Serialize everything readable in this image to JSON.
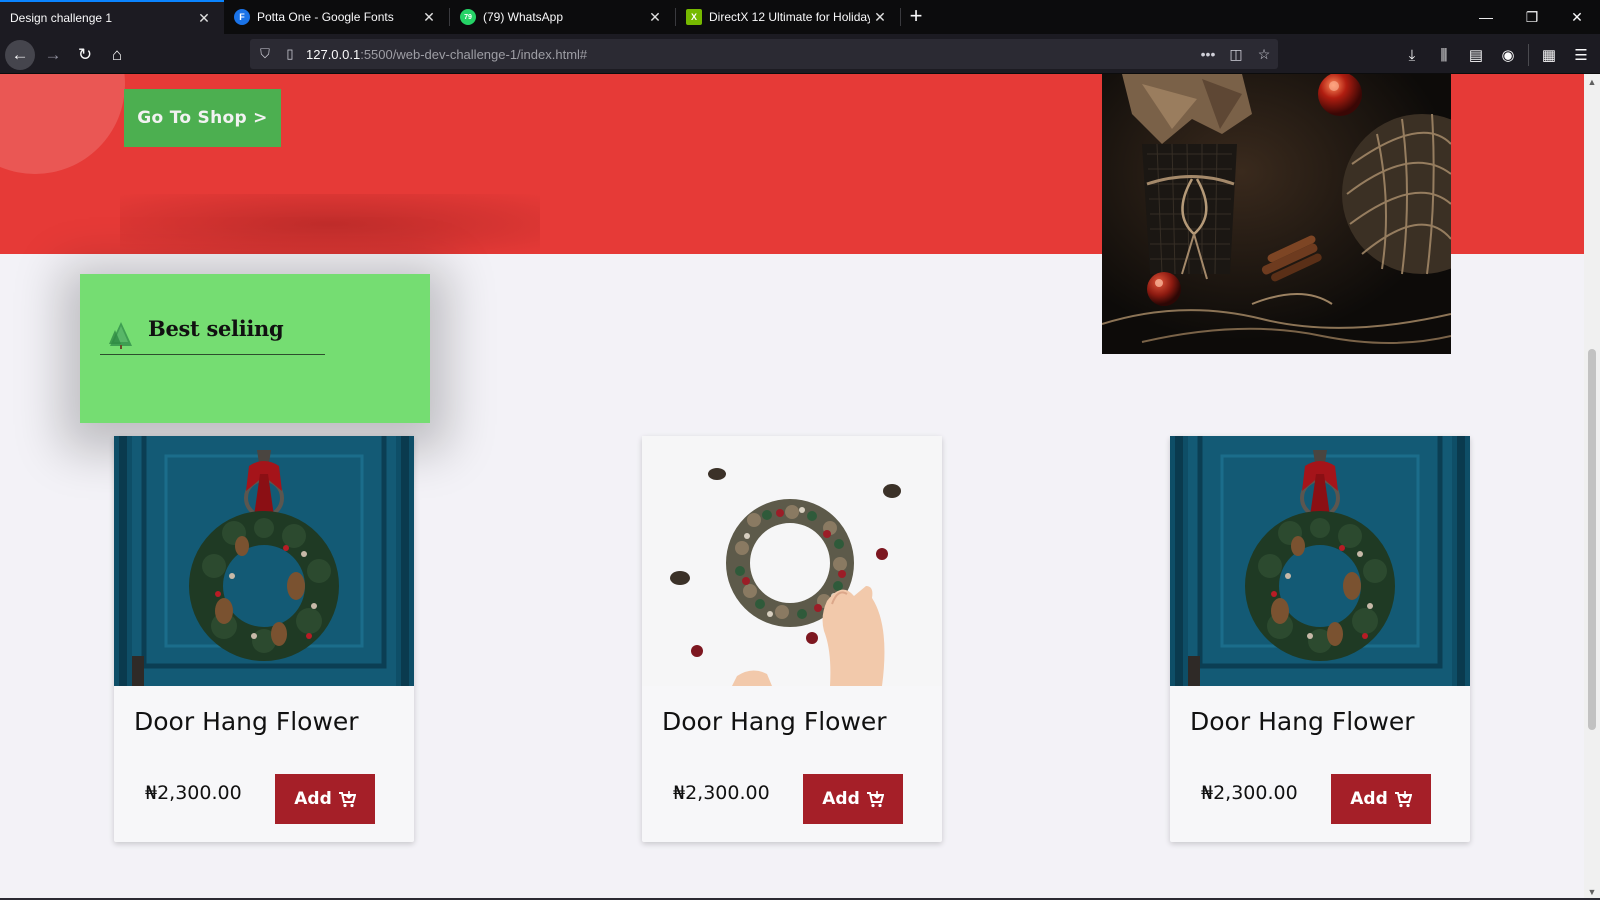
{
  "browser": {
    "tabs": [
      {
        "title": "Design challenge 1",
        "active": true,
        "icon": "none"
      },
      {
        "title": "Potta One - Google Fonts",
        "active": false,
        "icon": "google-fonts-icon",
        "icon_letter": "F",
        "icon_color": "#1a73e8"
      },
      {
        "title": "(79) WhatsApp",
        "active": false,
        "icon": "whatsapp-icon",
        "icon_letter": "79",
        "icon_color": "#25d366"
      },
      {
        "title": "DirectX 12 Ultimate for Holiday",
        "active": false,
        "icon": "nvidia-icon",
        "icon_letter": "X",
        "icon_color": "#76b900"
      }
    ],
    "url_host": "127.0.0.1",
    "url_rest": ":5500/web-dev-challenge-1/index.html#"
  },
  "hero": {
    "shop_button": "Go To Shop >",
    "colors": {
      "background": "#e63a37",
      "button": "#4caf50"
    }
  },
  "best_selling": {
    "heading": "Best seliing",
    "icon": "pine-tree-icon",
    "color": "#75dd72"
  },
  "products": [
    {
      "name": "Door Hang Flower",
      "price": "₦2,300.00",
      "add_label": "Add",
      "image": "blue-door-wreath"
    },
    {
      "name": "Door Hang Flower",
      "price": "₦2,300.00",
      "add_label": "Add",
      "image": "white-wreath-hands"
    },
    {
      "name": "Door Hang Flower",
      "price": "₦2,300.00",
      "add_label": "Add",
      "image": "blue-door-wreath"
    }
  ],
  "colors": {
    "add_button": "#a51f28",
    "page_background": "#f3f2f7"
  }
}
